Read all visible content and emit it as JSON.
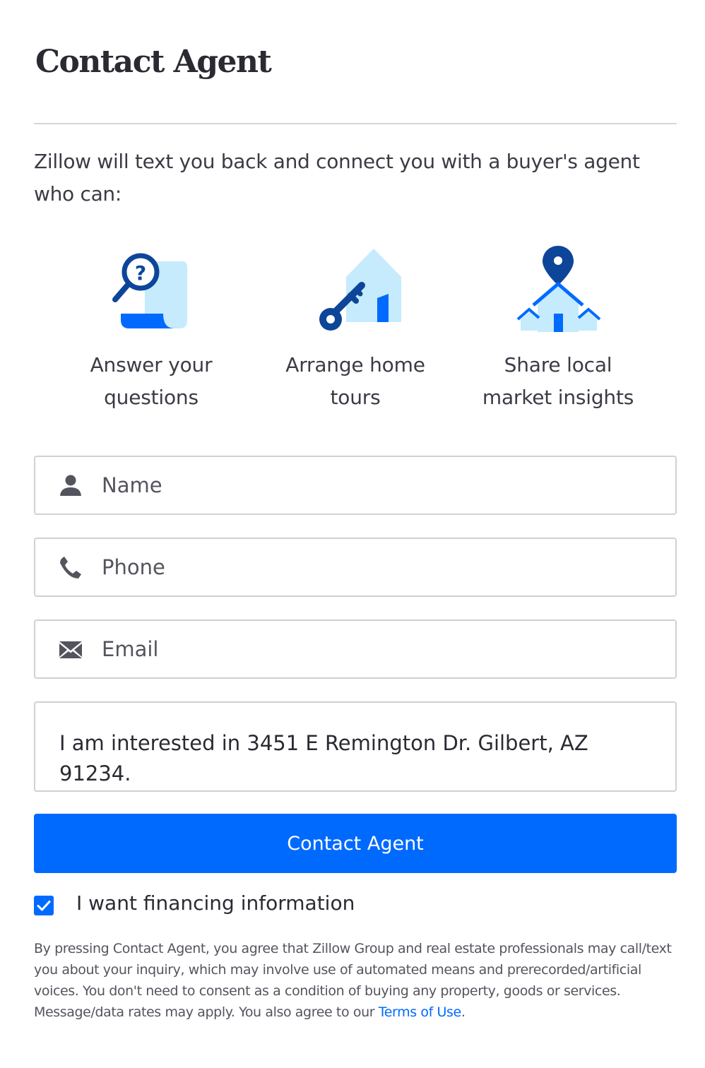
{
  "header": {
    "title": "Contact Agent"
  },
  "intro": {
    "text": "Zillow will text you back and connect you with a buyer's agent who can:"
  },
  "features": [
    {
      "icon": "magnifier-question-icon",
      "label_line1": "Answer your",
      "label_line2": "questions"
    },
    {
      "icon": "house-key-icon",
      "label_line1": "Arrange home",
      "label_line2": "tours"
    },
    {
      "icon": "house-pin-icon",
      "label_line1": "Share local",
      "label_line2": "market insights"
    }
  ],
  "form": {
    "name": {
      "placeholder": "Name",
      "value": "",
      "icon": "person-icon"
    },
    "phone": {
      "placeholder": "Phone",
      "value": "",
      "icon": "phone-icon"
    },
    "email": {
      "placeholder": "Email",
      "value": "",
      "icon": "envelope-icon"
    },
    "message": {
      "value": "I am interested in 3451 E Remington Dr. Gilbert, AZ 91234."
    },
    "submit_label": "Contact Agent",
    "financing": {
      "label": "I want financing information",
      "checked": true
    }
  },
  "legal": {
    "text": "By pressing Contact Agent, you agree that Zillow Group and real estate professionals may call/text you about your inquiry, which may involve use of automated means and prerecorded/artificial voices. You don't need to consent as a condition of buying any property, goods or services. Message/data rates may apply. You also agree to our ",
    "link_text": "Terms of Use",
    "trailing": "."
  },
  "colors": {
    "accent": "#006aff",
    "icon_dark": "#0d4599",
    "icon_light": "#c5ebfc",
    "text": "#2a2a33"
  }
}
